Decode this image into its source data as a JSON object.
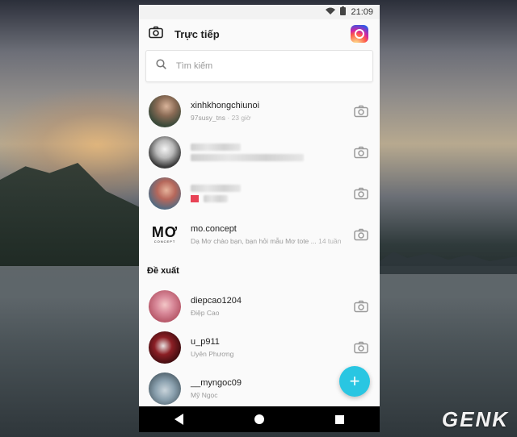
{
  "status": {
    "time": "21:09"
  },
  "header": {
    "title": "Trực tiếp"
  },
  "search": {
    "placeholder": "Tìm kiếm"
  },
  "conversations": [
    {
      "name": "xinhkhongchiunoi",
      "subtitle": "97susy_tns",
      "time": "23 giờ"
    },
    {
      "name": "",
      "subtitle": "",
      "time": ""
    },
    {
      "name": "",
      "subtitle": "",
      "time": ""
    },
    {
      "name": "mo.concept",
      "subtitle": "Dạ Mơ chào bạn, bạn hỏi mẫu Mơ tote ...",
      "time": "14 tuần"
    }
  ],
  "mo_logo": {
    "big": "MƠ",
    "small": "CONCEPT"
  },
  "suggestions_title": "Đề xuất",
  "suggestions": [
    {
      "name": "diepcao1204",
      "subtitle": "Điệp Cao"
    },
    {
      "name": "u_p911",
      "subtitle": "Uyên Phương"
    },
    {
      "name": "__myngoc09",
      "subtitle": "Mỹ Ngọc"
    }
  ],
  "fab": {
    "symbol": "+"
  },
  "watermark": "GENK"
}
